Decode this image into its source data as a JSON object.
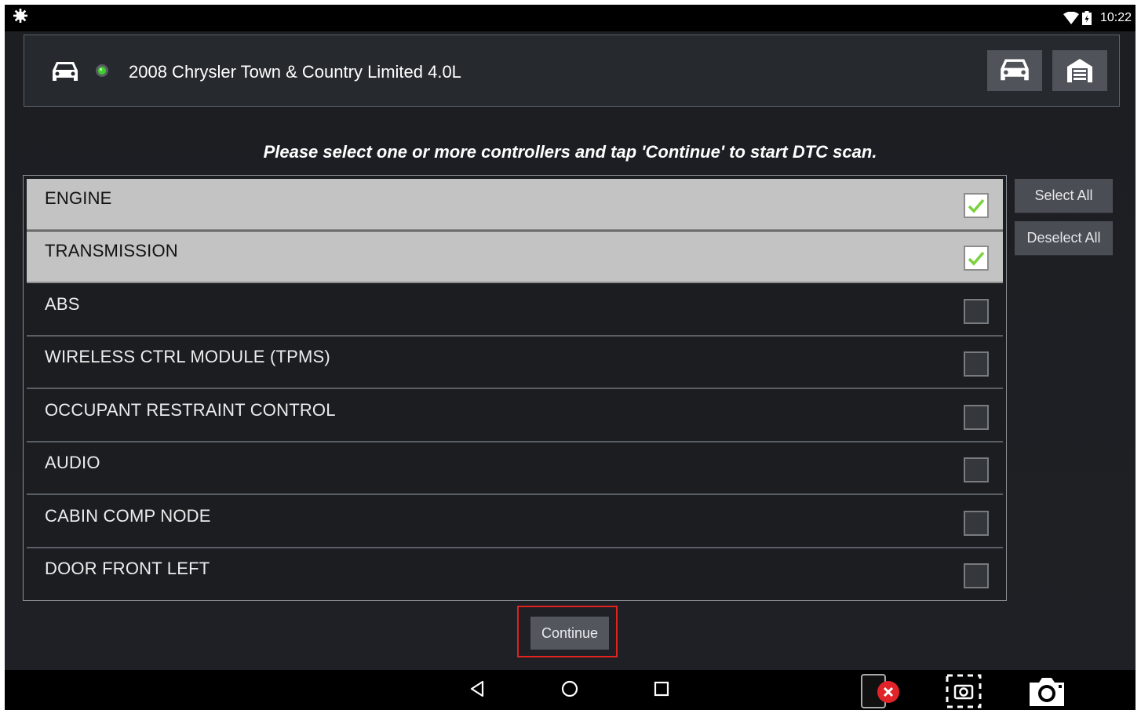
{
  "status_bar": {
    "time": "10:22",
    "icons": [
      "gear-icon",
      "wifi-icon",
      "battery-icon"
    ]
  },
  "header": {
    "vehicle_name": "2008 Chrysler Town & Country Limited 4.0L",
    "connection_status_color": "#3fcf2f",
    "icons": [
      "car-icon",
      "status-led-icon",
      "vehicle-button-car-icon",
      "garage-icon"
    ]
  },
  "instruction": "Please select one or more controllers and tap 'Continue' to start DTC scan.",
  "controllers": [
    {
      "label": "ENGINE",
      "checked": true
    },
    {
      "label": "TRANSMISSION",
      "checked": true
    },
    {
      "label": "ABS",
      "checked": false
    },
    {
      "label": "WIRELESS CTRL MODULE (TPMS)",
      "checked": false
    },
    {
      "label": "OCCUPANT RESTRAINT CONTROL",
      "checked": false
    },
    {
      "label": "AUDIO",
      "checked": false
    },
    {
      "label": "CABIN COMP NODE",
      "checked": false
    },
    {
      "label": "DOOR FRONT LEFT",
      "checked": false
    }
  ],
  "actions": {
    "select_all": "Select All",
    "deselect_all": "Deselect All",
    "continue": "Continue"
  },
  "nav_bar": {
    "icons": [
      "back-icon",
      "home-icon",
      "recents-icon",
      "close-app-icon",
      "screenshot-region-icon",
      "camera-icon"
    ]
  },
  "colors": {
    "selected_row": "#c3c3c3",
    "check_mark": "#7bd13f",
    "highlight_border": "#e2221d"
  }
}
